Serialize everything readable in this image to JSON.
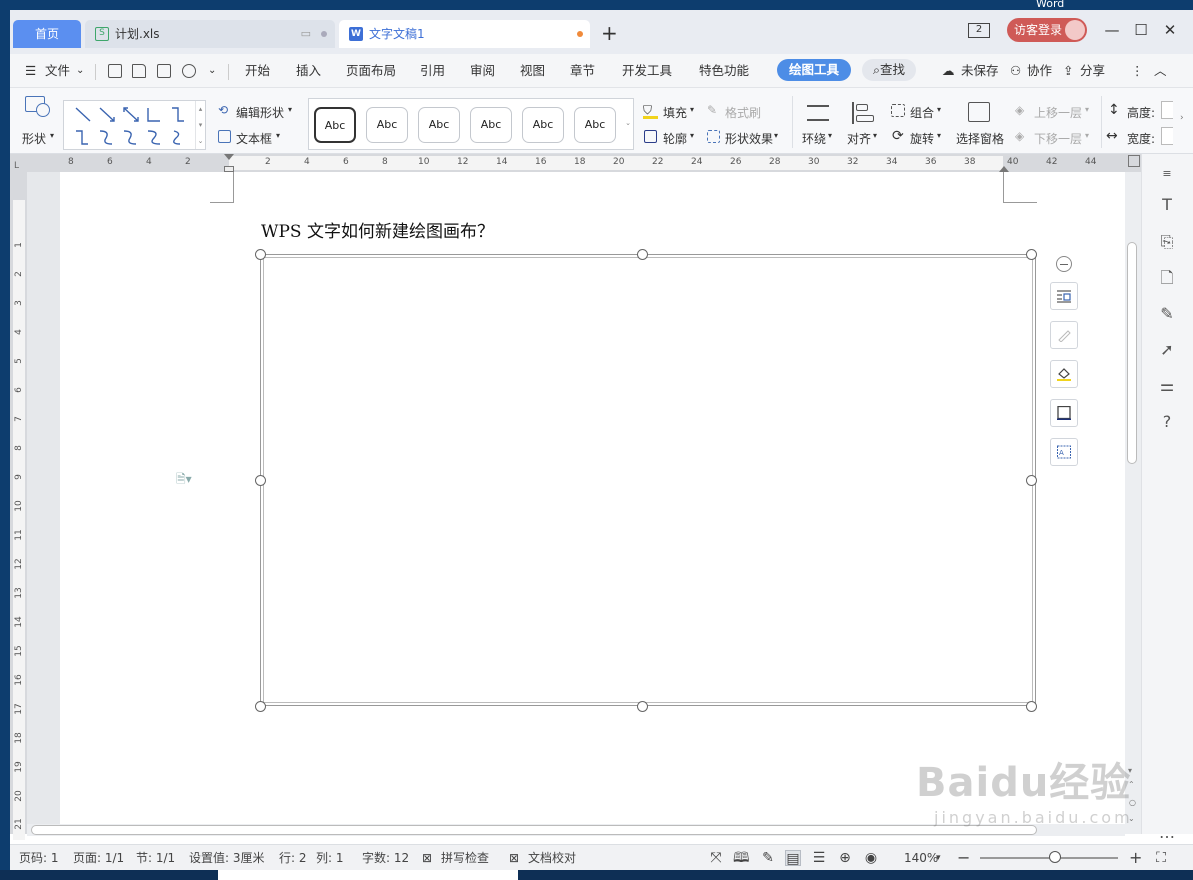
{
  "desktop": {
    "corner_text": "Word"
  },
  "tabs": {
    "home": "首页",
    "xls": "计划.xls",
    "active": "文字文稿1",
    "add": "+"
  },
  "titlebar": {
    "workspace_count": "2",
    "login": "访客登录",
    "minimize": "—",
    "maximize": "☐",
    "close": "✕"
  },
  "menu": {
    "file": "文件",
    "items": [
      "开始",
      "插入",
      "页面布局",
      "引用",
      "审阅",
      "视图",
      "章节",
      "开发工具",
      "特色功能"
    ],
    "drawing_tools": "绘图工具",
    "find": "查找",
    "unsaved": "未保存",
    "collaborate": "协作",
    "share": "分享"
  },
  "ribbon": {
    "shape": "形状",
    "edit_shape": "编辑形状",
    "text_box": "文本框",
    "style_presets": [
      "Abc",
      "Abc",
      "Abc",
      "Abc",
      "Abc",
      "Abc"
    ],
    "fill": "填充",
    "format_painter": "格式刷",
    "outline": "轮廓",
    "shape_effects": "形状效果",
    "wrap": "环绕",
    "align": "对齐",
    "group": "组合",
    "rotate": "旋转",
    "selection_pane": "选择窗格",
    "bring_forward": "上移一层",
    "send_backward": "下移一层",
    "height": "高度:",
    "width": "宽度:"
  },
  "ruler": {
    "h_numbers": [
      "8",
      "6",
      "4",
      "2",
      "2",
      "4",
      "6",
      "8",
      "10",
      "12",
      "14",
      "16",
      "18",
      "20",
      "22",
      "24",
      "26",
      "28",
      "30",
      "32",
      "34",
      "36",
      "38",
      "40",
      "42",
      "44"
    ],
    "v_numbers": [
      "1",
      "2",
      "3",
      "4",
      "5",
      "6",
      "7",
      "8",
      "9",
      "10",
      "11",
      "12",
      "13",
      "14",
      "15",
      "16",
      "17",
      "18",
      "19",
      "20",
      "21"
    ]
  },
  "document": {
    "title": "WPS 文字如何新建绘图画布？"
  },
  "status": {
    "page_no": "页码: 1",
    "pages": "页面: 1/1",
    "section": "节: 1/1",
    "setting": "设置值: 3厘米",
    "row": "行: 2",
    "col": "列: 1",
    "word_count": "字数: 12",
    "spell_check": "拼写检查",
    "doc_proof": "文档校对",
    "zoom": "140%"
  },
  "watermark": {
    "brand": "Baidu经验",
    "url": "jingyan.baidu.com"
  },
  "colors": {
    "active_tab": "#5b8ff0",
    "drawing_tools_pill": "#4d8de6",
    "login_pill": "#cf5a57"
  }
}
